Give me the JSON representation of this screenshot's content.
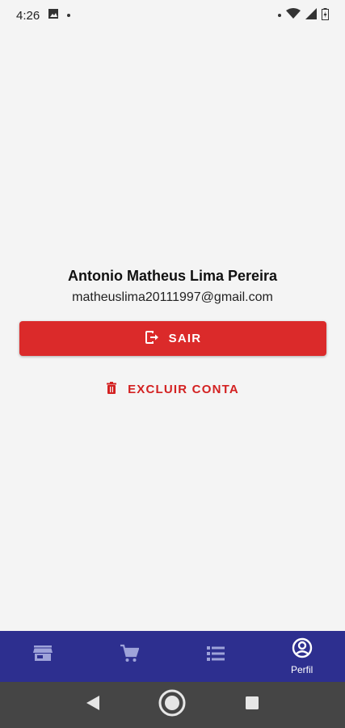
{
  "status_bar": {
    "time": "4:26"
  },
  "profile": {
    "name": "Antonio Matheus Lima Pereira",
    "email": "matheuslima20111997@gmail.com"
  },
  "actions": {
    "logout_label": "SAIR",
    "delete_label": "EXCLUIR CONTA"
  },
  "bottom_nav": {
    "items": [
      {
        "icon": "store-icon",
        "label": ""
      },
      {
        "icon": "cart-icon",
        "label": ""
      },
      {
        "icon": "list-icon",
        "label": ""
      },
      {
        "icon": "account-circle-icon",
        "label": "Perfil",
        "active": true
      }
    ]
  },
  "colors": {
    "primary": "#2d2f8f",
    "danger": "#db2a2a",
    "background": "#f4f4f4"
  }
}
